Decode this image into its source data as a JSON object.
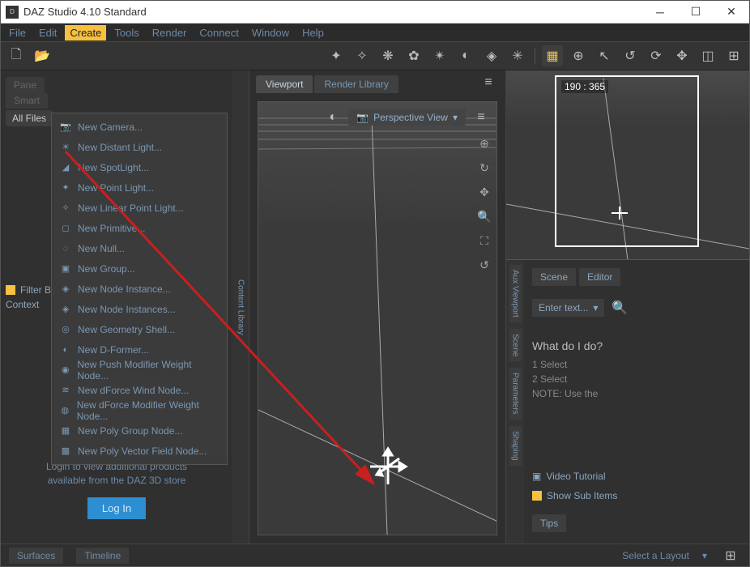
{
  "titlebar": {
    "title": "DAZ Studio 4.10 Standard"
  },
  "menubar": [
    "File",
    "Edit",
    "Create",
    "Tools",
    "Render",
    "Connect",
    "Window",
    "Help"
  ],
  "menu_active_index": 2,
  "create_menu": [
    "New Camera...",
    "New Distant Light...",
    "New SpotLight...",
    "New Point Light...",
    "New Linear Point Light...",
    "New Primitive...",
    "New Null...",
    "New Group...",
    "New Node Instance...",
    "New Node Instances...",
    "New Geometry Shell...",
    "New D-Former...",
    "New Push Modifier Weight Node...",
    "New dForce Wind Node...",
    "New dForce Modifier Weight Node...",
    "New Poly Group Node...",
    "New Poly Vector Field Node..."
  ],
  "left": {
    "filter_label": "Filter By",
    "context_label": "Context",
    "all_files": "All Files",
    "login_text1": "Login to view additional products",
    "login_text2": "available from the DAZ 3D store",
    "login_btn": "Log In"
  },
  "center": {
    "tabs": [
      "Viewport",
      "Render Library"
    ],
    "active_tab": 0,
    "view_select": "Perspective View",
    "side_label": "Content Library"
  },
  "right": {
    "coords": "190 : 365",
    "tabs": [
      "Scene",
      "Editor"
    ],
    "enter_label": "Enter text...",
    "whatdo_title": "What do I do?",
    "step1": "1  Select",
    "step2": "2  Select",
    "notelabel": "NOTE: Use the",
    "showsub": "Show Sub Items",
    "video": "Video Tutorial",
    "side_tabs": [
      "Aux Viewport",
      "Scene",
      "Parameters",
      "Shaping"
    ],
    "bottom_tab": "Tips"
  },
  "bottom": {
    "surfaces": "Surfaces",
    "timeline": "Timeline",
    "select": "Select a Layout"
  }
}
